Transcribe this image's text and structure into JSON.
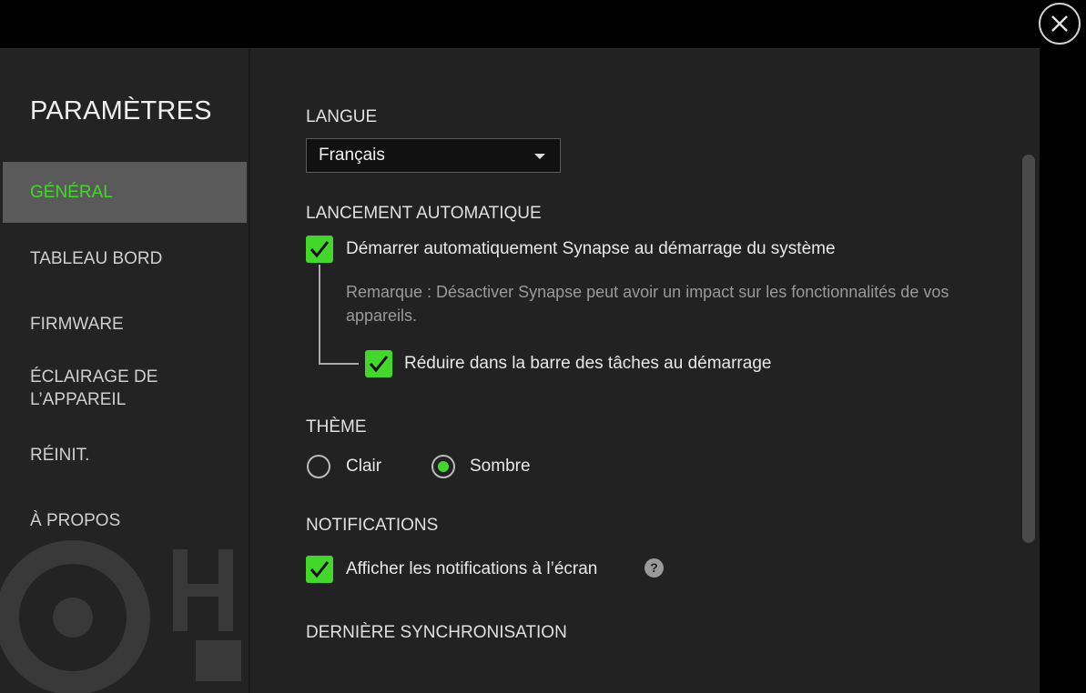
{
  "sidebar": {
    "title": "PARAMÈTRES",
    "items": [
      {
        "label": "GÉNÉRAL",
        "active": true
      },
      {
        "label": "TABLEAU BORD"
      },
      {
        "label": "FIRMWARE"
      },
      {
        "label": "ÉCLAIRAGE DE L’APPAREIL"
      },
      {
        "label": "RÉINIT."
      },
      {
        "label": "À PROPOS"
      }
    ]
  },
  "language": {
    "title": "LANGUE",
    "selected": "Français"
  },
  "autostart": {
    "title": "LANCEMENT AUTOMATIQUE",
    "start_label": "Démarrer automatiquement Synapse au démarrage du système",
    "note": "Remarque : Désactiver Synapse peut avoir un impact sur les fonctionnalités de vos appareils.",
    "minimize_label": "Réduire dans la barre des tâches au démarrage"
  },
  "theme": {
    "title": "THÈME",
    "options": [
      "Clair",
      "Sombre"
    ],
    "selected": "Sombre"
  },
  "notifications": {
    "title": "NOTIFICATIONS",
    "show_label": "Afficher les notifications à l’écran",
    "help_glyph": "?"
  },
  "sync": {
    "title": "DERNIÈRE SYNCHRONISATION"
  },
  "colors": {
    "accent": "#44d62c",
    "panel": "#222222",
    "active_nav": "#5a5a5a"
  },
  "icons": [
    "close-icon",
    "checkmark-icon",
    "chevron-down-icon",
    "help-icon"
  ]
}
